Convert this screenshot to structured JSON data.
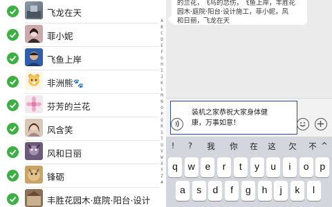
{
  "contacts": [
    {
      "name": "飞龙在天"
    },
    {
      "name": "菲小妮"
    },
    {
      "name": "飞鱼上岸"
    },
    {
      "name": "非洲熊🐾"
    },
    {
      "name": "芬芳的兰花"
    },
    {
      "name": "风含笑"
    },
    {
      "name": "风和日丽"
    },
    {
      "name": "锋砺"
    },
    {
      "name": "丰胜花园木·庭院·阳台·设计"
    }
  ],
  "alphabet_index": [
    "A",
    "B",
    "C",
    "D",
    "E",
    "F",
    "G",
    "H",
    "I",
    "J",
    "K",
    "L",
    "M",
    "N",
    "O",
    "P",
    "Q",
    "R",
    "S",
    "T",
    "U",
    "V",
    "W",
    "X",
    "Y",
    "Z",
    "#"
  ],
  "chat": {
    "received_line1": "的兰花，飞鸟的恋伤，飞鱼上岸，丰胜花",
    "received_line2": "园木·庭院·阳台·设计施工，菲小妮，风",
    "received_line3": "和日丽，飞龙在天"
  },
  "composer": {
    "text_line1": "装机之家恭祝大家身体健",
    "text_line2": "康，万事如意！"
  },
  "keyboard": {
    "suggestions": [
      "!",
      "?",
      "我",
      "你",
      "在",
      "这",
      "欠",
      "不",
      "^"
    ],
    "row1": [
      "q",
      "w",
      "e",
      "r",
      "t",
      "y",
      "u",
      "i",
      "o",
      "p"
    ],
    "row2": [
      "a",
      "s",
      "d",
      "f",
      "g",
      "h",
      "j",
      "k",
      "l"
    ]
  },
  "colors": {
    "check_green": "#3cb043",
    "composer_border": "#2e4aa8",
    "chat_bg": "#ebebeb"
  }
}
